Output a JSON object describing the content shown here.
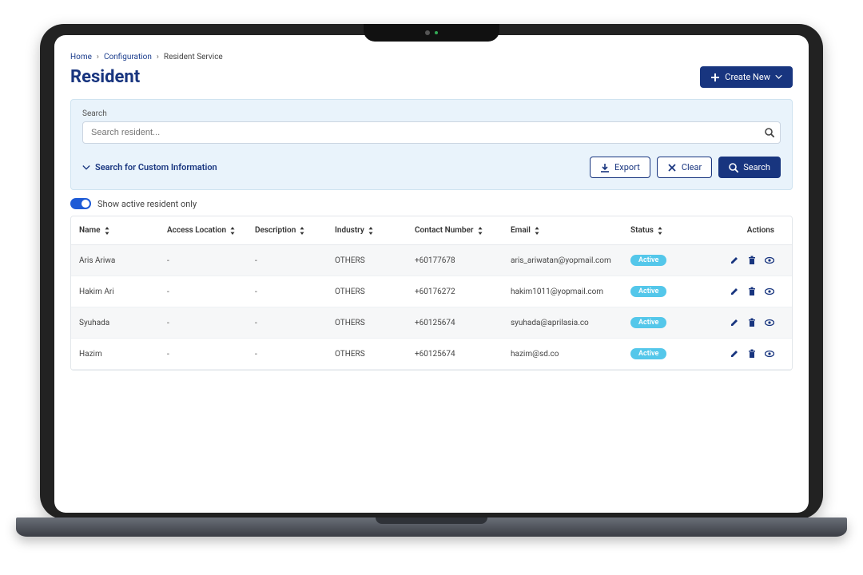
{
  "breadcrumb": {
    "home": "Home",
    "config": "Configuration",
    "service": "Resident Service"
  },
  "page_title": "Resident",
  "create_button": "Create New",
  "search": {
    "label": "Search",
    "placeholder": "Search resident...",
    "custom_link": "Search for Custom Information",
    "export": "Export",
    "clear": "Clear",
    "search_btn": "Search"
  },
  "toggle_label": "Show active resident only",
  "columns": {
    "name": "Name",
    "access_location": "Access Location",
    "description": "Description",
    "industry": "Industry",
    "contact": "Contact Number",
    "email": "Email",
    "status": "Status",
    "actions": "Actions"
  },
  "status_active": "Active",
  "rows": [
    {
      "name": "Aris Ariwa",
      "access_location": "-",
      "description": "-",
      "industry": "OTHERS",
      "contact": "+60177678",
      "email": "aris_ariwatan@yopmail.com",
      "status": "Active"
    },
    {
      "name": "Hakim Ari",
      "access_location": "-",
      "description": "-",
      "industry": "OTHERS",
      "contact": "+60176272",
      "email": "hakim1011@yopmail.com",
      "status": "Active"
    },
    {
      "name": "Syuhada",
      "access_location": "-",
      "description": "-",
      "industry": "OTHERS",
      "contact": "+60125674",
      "email": "syuhada@aprilasia.co",
      "status": "Active"
    },
    {
      "name": "Hazim",
      "access_location": "-",
      "description": "-",
      "industry": "OTHERS",
      "contact": "+60125674",
      "email": "hazim@sd.co",
      "status": "Active"
    }
  ]
}
